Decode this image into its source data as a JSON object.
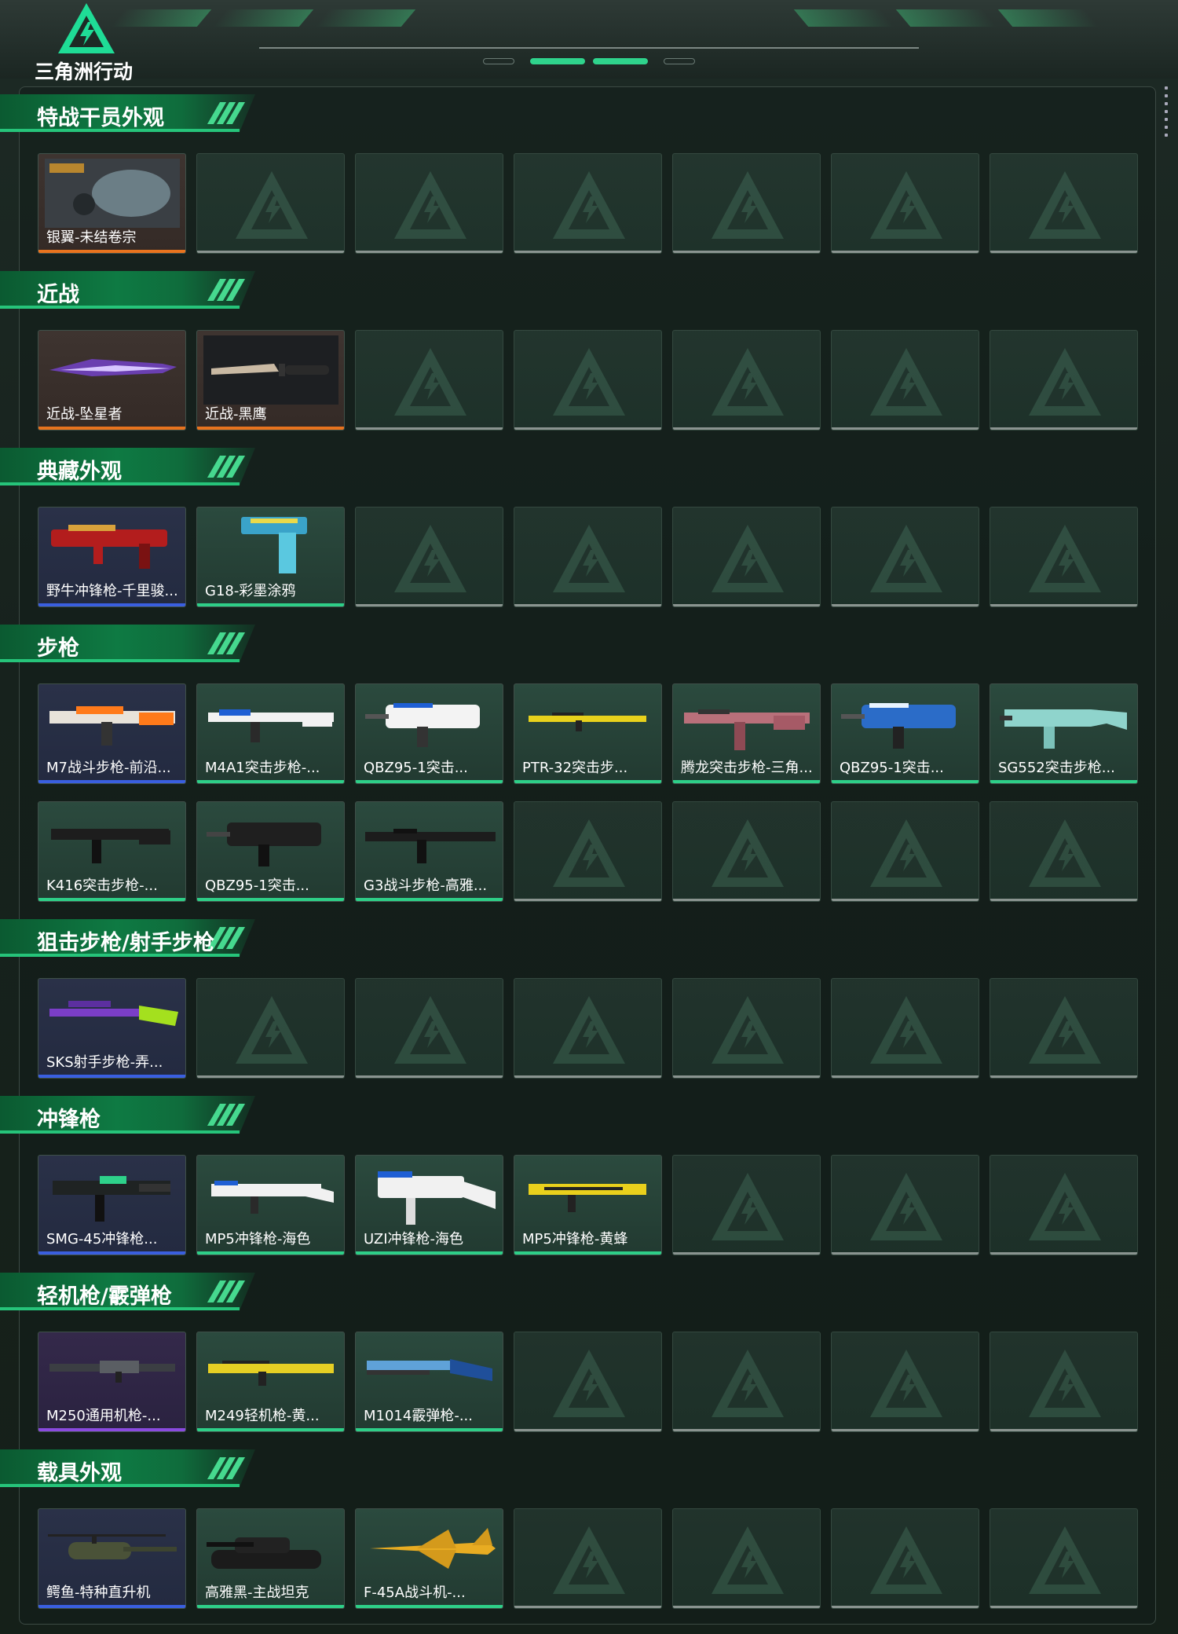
{
  "app": {
    "logo_text": "三角洲行动"
  },
  "sections": [
    {
      "title": "特战干员外观",
      "items": [
        {
          "name": "银翼-未结卷宗",
          "rarity": "orange",
          "icon": "operator-portrait"
        }
      ]
    },
    {
      "title": "近战",
      "items": [
        {
          "name": "近战-坠星者",
          "rarity": "orange",
          "icon": "blade"
        },
        {
          "name": "近战-黑鹰",
          "rarity": "orange",
          "icon": "knife"
        }
      ]
    },
    {
      "title": "典藏外观",
      "items": [
        {
          "name": "野牛冲锋枪-千里骏...",
          "rarity": "blue",
          "icon": "smg-red"
        },
        {
          "name": "G18-彩墨涂鸦",
          "rarity": "green",
          "icon": "pistol-graffiti"
        }
      ]
    },
    {
      "title": "步枪",
      "items": [
        {
          "name": "M7战斗步枪-前沿...",
          "rarity": "blue",
          "icon": "rifle-orange"
        },
        {
          "name": "M4A1突击步枪-...",
          "rarity": "green",
          "icon": "rifle-white-blue"
        },
        {
          "name": "QBZ95-1突击...",
          "rarity": "green",
          "icon": "bullpup-white"
        },
        {
          "name": "PTR-32突击步...",
          "rarity": "green",
          "icon": "rifle-yellow-thin"
        },
        {
          "name": "腾龙突击步枪-三角...",
          "rarity": "green",
          "icon": "rifle-pink-camo"
        },
        {
          "name": "QBZ95-1突击...",
          "rarity": "green",
          "icon": "bullpup-blue"
        },
        {
          "name": "SG552突击步枪...",
          "rarity": "green",
          "icon": "rifle-teal"
        },
        {
          "name": "K416突击步枪-...",
          "rarity": "green",
          "icon": "rifle-black"
        },
        {
          "name": "QBZ95-1突击...",
          "rarity": "green",
          "icon": "bullpup-black"
        },
        {
          "name": "G3战斗步枪-高雅...",
          "rarity": "green",
          "icon": "rifle-black-long"
        }
      ]
    },
    {
      "title": "狙击步枪/射手步枪",
      "items": [
        {
          "name": "SKS射手步枪-弄...",
          "rarity": "blue",
          "icon": "dmr-lime"
        }
      ]
    },
    {
      "title": "冲锋枪",
      "items": [
        {
          "name": "SMG-45冲锋枪...",
          "rarity": "blue",
          "icon": "smg-black-green"
        },
        {
          "name": "MP5冲锋枪-海色",
          "rarity": "green",
          "icon": "smg-white-blue"
        },
        {
          "name": "UZI冲锋枪-海色",
          "rarity": "green",
          "icon": "uzi-white-blue"
        },
        {
          "name": "MP5冲锋枪-黄蜂",
          "rarity": "green",
          "icon": "smg-yellow"
        }
      ]
    },
    {
      "title": "轻机枪/霰弹枪",
      "items": [
        {
          "name": "M250通用机枪-...",
          "rarity": "purple",
          "icon": "lmg-dark"
        },
        {
          "name": "M249轻机枪-黄...",
          "rarity": "green",
          "icon": "lmg-yellow"
        },
        {
          "name": "M1014霰弹枪-...",
          "rarity": "green",
          "icon": "shotgun-blue"
        }
      ]
    },
    {
      "title": "载具外观",
      "items": [
        {
          "name": "鳄鱼-特种直升机",
          "rarity": "blue",
          "icon": "helicopter"
        },
        {
          "name": "高雅黑-主战坦克",
          "rarity": "green",
          "icon": "tank"
        },
        {
          "name": "F-45A战斗机-...",
          "rarity": "green",
          "icon": "jet-yellow"
        }
      ]
    }
  ]
}
